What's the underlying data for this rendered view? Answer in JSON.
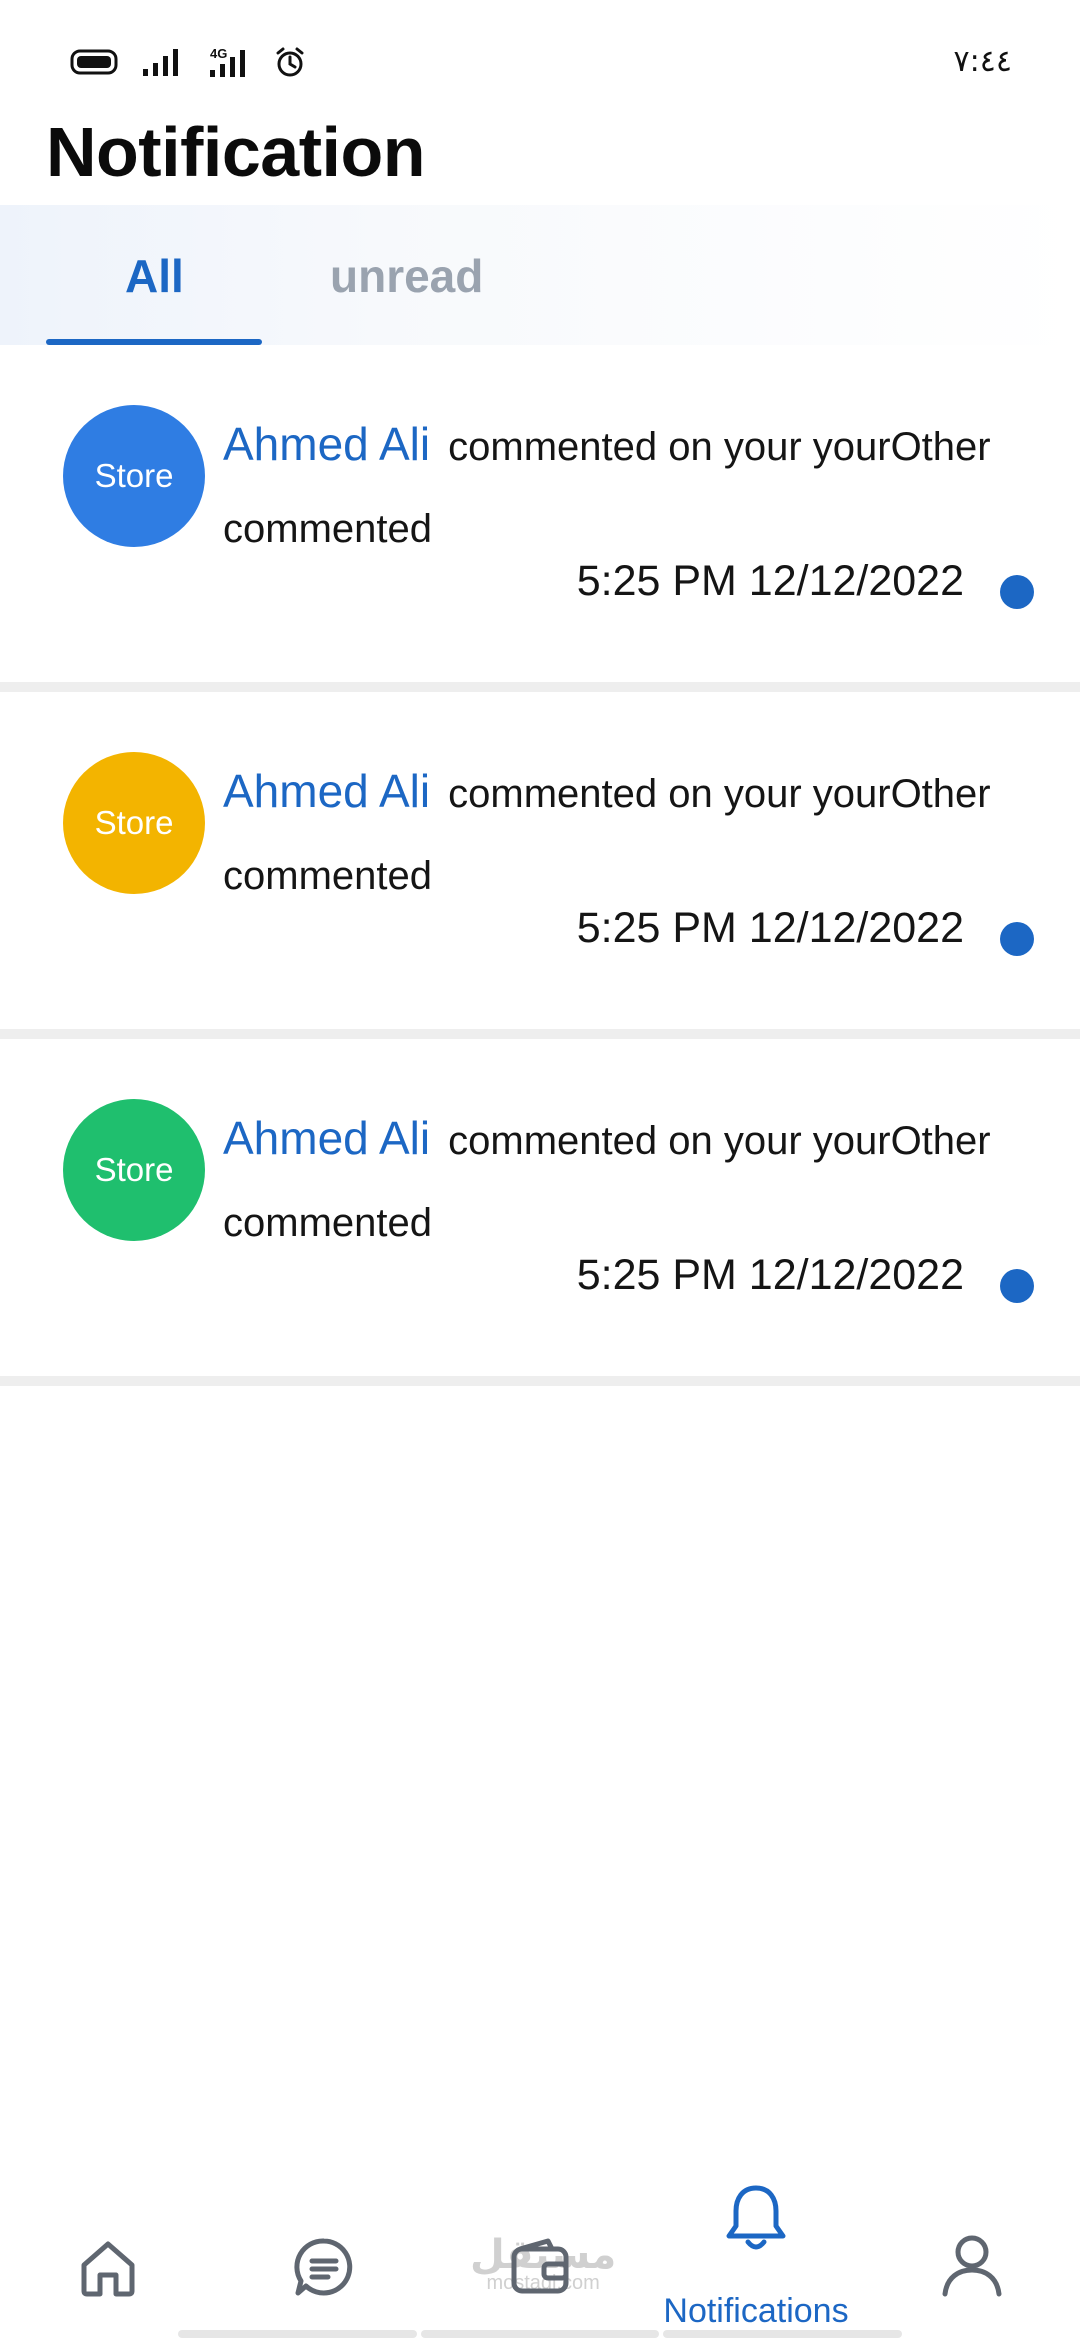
{
  "status_bar": {
    "time": "٧:٤٤",
    "network": "4G",
    "icons": [
      "battery-icon",
      "signal-icon",
      "signal-4g-icon",
      "alarm-icon"
    ]
  },
  "page": {
    "title": "Notification"
  },
  "tabs": [
    {
      "label": "All",
      "active": true
    },
    {
      "label": "unread",
      "active": false
    }
  ],
  "notifications": [
    {
      "avatar_label": "Store",
      "avatar_color": "#2f7de3",
      "name": "Ahmed Ali",
      "message": "commented on your  yourOther commented",
      "time": "5:25 PM 12/12/2022",
      "unread": true
    },
    {
      "avatar_label": "Store",
      "avatar_color": "#f3b400",
      "name": "Ahmed Ali",
      "message": "commented on your  yourOther commented",
      "time": "5:25 PM 12/12/2022",
      "unread": true
    },
    {
      "avatar_label": "Store",
      "avatar_color": "#1fbf6e",
      "name": "Ahmed Ali",
      "message": "commented on your  yourOther commented",
      "time": "5:25 PM 12/12/2022",
      "unread": true
    }
  ],
  "bottom_nav": {
    "items": [
      {
        "icon": "home-icon",
        "label": ""
      },
      {
        "icon": "chat-icon",
        "label": ""
      },
      {
        "icon": "wallet-icon",
        "label": ""
      },
      {
        "icon": "bell-icon",
        "label": "Notifications",
        "active": true
      },
      {
        "icon": "user-icon",
        "label": ""
      }
    ]
  },
  "watermark": {
    "arabic": "مستقل",
    "latin": "mostaql.com"
  },
  "colors": {
    "accent": "#1c67c4",
    "inactive_tab": "#9aa3af",
    "icon_gray": "#5f6670"
  }
}
